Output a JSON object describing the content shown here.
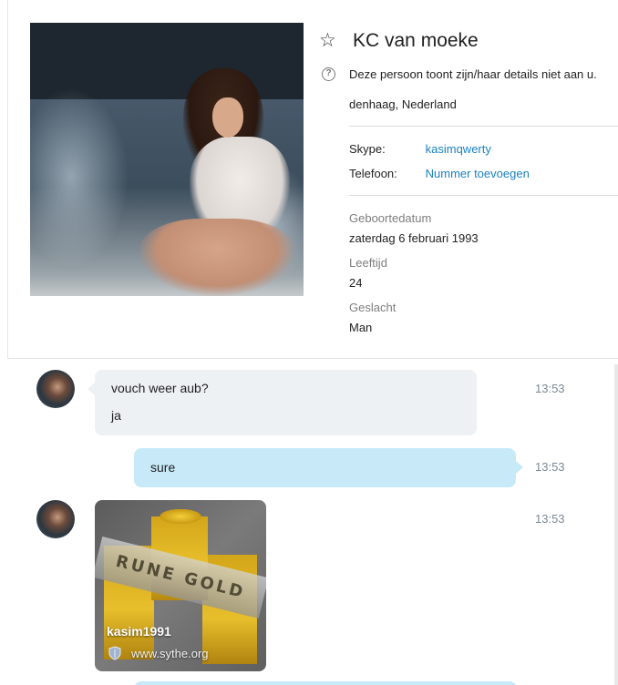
{
  "profile": {
    "name": "KC van moeke",
    "privacy_notice": "Deze persoon toont zijn/haar details niet aan u.",
    "location": "denhaag, Nederland",
    "contact": {
      "skype_label": "Skype:",
      "skype_value": "kasimqwerty",
      "phone_label": "Telefoon:",
      "phone_value": "Nummer toevoegen"
    },
    "details": {
      "birthdate_label": "Geboortedatum",
      "birthdate_value": "zaterdag 6 februari 1993",
      "age_label": "Leeftijd",
      "age_value": "24",
      "gender_label": "Geslacht",
      "gender_value": "Man"
    }
  },
  "chat": {
    "messages": [
      {
        "direction": "incoming",
        "lines": [
          "vouch weer aub?",
          "ja"
        ],
        "time": "13:53"
      },
      {
        "direction": "outgoing",
        "lines": [
          "sure"
        ],
        "time": "13:53"
      },
      {
        "direction": "incoming",
        "type": "link_preview",
        "time": "13:53",
        "link": {
          "title": "kasim1991",
          "domain": "www.sythe.org",
          "image_text": "RUNE GOLD"
        }
      }
    ]
  },
  "colors": {
    "link_blue": "#1a82c0",
    "incoming_bubble": "#eef1f4",
    "outgoing_bubble": "#c7e9f8",
    "timestamp": "#7a8a94"
  }
}
